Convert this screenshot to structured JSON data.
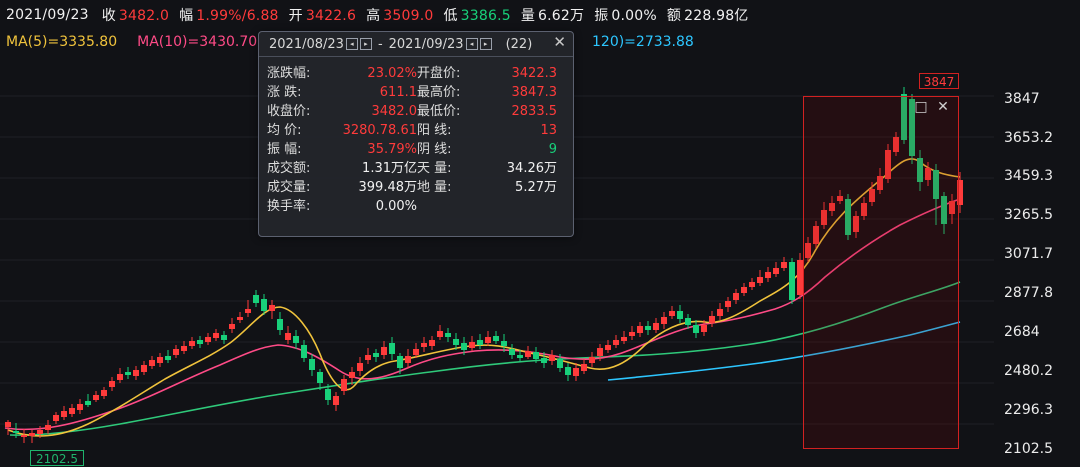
{
  "top_bar": {
    "date": "2021/09/23",
    "close_label": "收",
    "close_value": "3482.0",
    "change_pct_label": "幅",
    "change_pct_value": "1.99%/6.88",
    "open_label": "开",
    "open_value": "3422.6",
    "high_label": "高",
    "high_value": "3509.0",
    "low_label": "低",
    "low_value": "3386.5",
    "volume_label": "量",
    "volume_value": "6.62万",
    "diff_label": "振",
    "diff_value": "0.00%",
    "amount_label": "额",
    "amount_value": "228.98亿"
  },
  "ma_bar": {
    "ma5": "MA(5)=3335.80",
    "ma10": "MA(10)=3430.70",
    "ma120": "120)=2733.88"
  },
  "popup": {
    "start_date": "2021/08/23",
    "separator": "-",
    "end_date": "2021/09/23",
    "count": "(22)",
    "close_symbol": "✕",
    "rows": [
      {
        "left_label": "涨跌幅:",
        "left_value": "23.02%",
        "right_label": "开盘价:",
        "right_value": "3422.3"
      },
      {
        "left_label": "涨 跌:",
        "left_value": "611.1",
        "right_label": "最高价:",
        "right_value": "3847.3"
      },
      {
        "left_label": "收盘价:",
        "left_value": "3482.0",
        "right_label": "最低价:",
        "right_value": "2833.5"
      },
      {
        "left_label": "均 价:",
        "left_value": "3280.78.61",
        "right_label": "阳 线:",
        "right_value": "13"
      },
      {
        "left_label": "振 幅:",
        "left_value": "35.79%",
        "right_label": "阴 线:",
        "right_value": "9"
      },
      {
        "left_label": "成交额:",
        "left_value": "1.31万亿",
        "right_label": "天 量:",
        "right_value": "34.26万"
      },
      {
        "left_label": "成交量:",
        "left_value": "399.48万",
        "right_label": "地 量:",
        "right_value": "5.27万"
      },
      {
        "left_label": "换手率:",
        "left_value": "0.00%",
        "right_label": "",
        "right_value": ""
      }
    ]
  },
  "selection": {
    "top_tag": "3847",
    "left_tag": "2102.5",
    "window_icon": "□",
    "close_icon": "✕"
  },
  "price_axis": {
    "labels": [
      "3847",
      "3653.2",
      "3459.3",
      "3265.5",
      "3071.7",
      "2877.8",
      "2684",
      "2480.2",
      "2296.3",
      "2102.5"
    ]
  },
  "colors": {
    "background": "#111216",
    "up": "#ff3b3b",
    "down": "#18d07a",
    "ma5": "#f0c33c",
    "ma10": "#ff4b87",
    "ma30": "#2fc97a",
    "ma120": "#2dc6ff",
    "selection": "#d22121"
  }
}
